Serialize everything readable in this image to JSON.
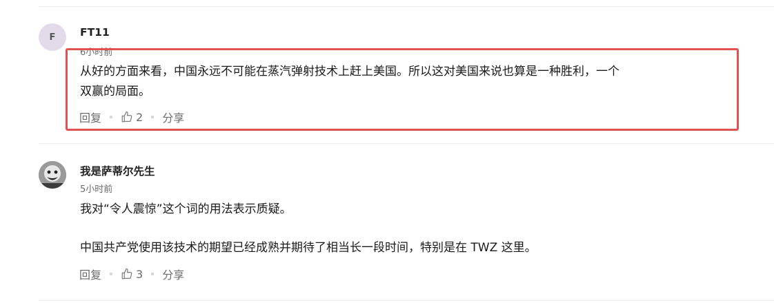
{
  "comments": [
    {
      "avatar_letter": "F",
      "username": "FT11",
      "time": "6小时前",
      "body_lines": [
        "从好的方面来看，中国永远不可能在蒸汽弹射技术上赶上美国。所以这对美国来说也算是一种胜利，一个",
        "双赢的局面。"
      ],
      "reply_label": "回复",
      "like_count": "2",
      "share_label": "分享"
    },
    {
      "avatar_icon": "user-photo-avatar",
      "username": "我是萨蒂尔先生",
      "time": "5小时前",
      "body_lines": [
        "我对“令人震惊”这个词的用法表示质疑。",
        "中国共产党使用该技术的期望已经成熟并期待了相当长一段时间，特别是在 TWZ 这里。"
      ],
      "reply_label": "回复",
      "like_count": "3",
      "share_label": "分享"
    }
  ],
  "highlight_color": "#e05252"
}
